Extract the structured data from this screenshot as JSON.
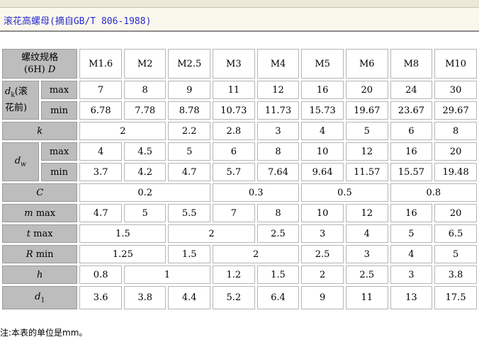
{
  "title": "滚花高螺母(摘自GB/T 806-1988)",
  "table": {
    "corner_label": "螺纹规格\n(6H) D",
    "sizes": [
      "M1.6",
      "M2",
      "M2.5",
      "M3",
      "M4",
      "M5",
      "M6",
      "M8",
      "M10"
    ],
    "dk_label": "dk(滚\n花前)",
    "max_label": "max",
    "min_label": "min",
    "dk_max": [
      "7",
      "8",
      "9",
      "11",
      "12",
      "16",
      "20",
      "24",
      "30"
    ],
    "dk_min": [
      "6.78",
      "7.78",
      "8.78",
      "10.73",
      "11.73",
      "15.73",
      "19.67",
      "23.67",
      "29.67"
    ],
    "k_label": "k",
    "k": [
      "2",
      "2.2",
      "2.8",
      "3",
      "4",
      "5",
      "6",
      "8"
    ],
    "dw_label": "dw",
    "dw_max": [
      "4",
      "4.5",
      "5",
      "6",
      "8",
      "10",
      "12",
      "16",
      "20"
    ],
    "dw_min": [
      "3.7",
      "4.2",
      "4.7",
      "5.7",
      "7.64",
      "9.64",
      "11.57",
      "15.57",
      "19.48"
    ],
    "c_label": "C",
    "c": [
      "0.2",
      "0.3",
      "0.5",
      "0.8"
    ],
    "m_label": "m max",
    "m": [
      "4.7",
      "5",
      "5.5",
      "7",
      "8",
      "10",
      "12",
      "16",
      "20"
    ],
    "t_label": "t max",
    "t": [
      "1.5",
      "2",
      "2.5",
      "3",
      "4",
      "5",
      "6.5"
    ],
    "r_label": "R min",
    "r": [
      "1.25",
      "1.5",
      "2",
      "2.5",
      "3",
      "4",
      "5"
    ],
    "h_label": "h",
    "h": [
      "0.8",
      "1",
      "1.2",
      "1.5",
      "2",
      "2.5",
      "3",
      "3.8"
    ],
    "d1_label": "d1",
    "d1": [
      "3.6",
      "3.8",
      "4.4",
      "5.2",
      "6.4",
      "9",
      "11",
      "13",
      "17.5"
    ]
  },
  "note": "注:本表的单位是mm。"
}
